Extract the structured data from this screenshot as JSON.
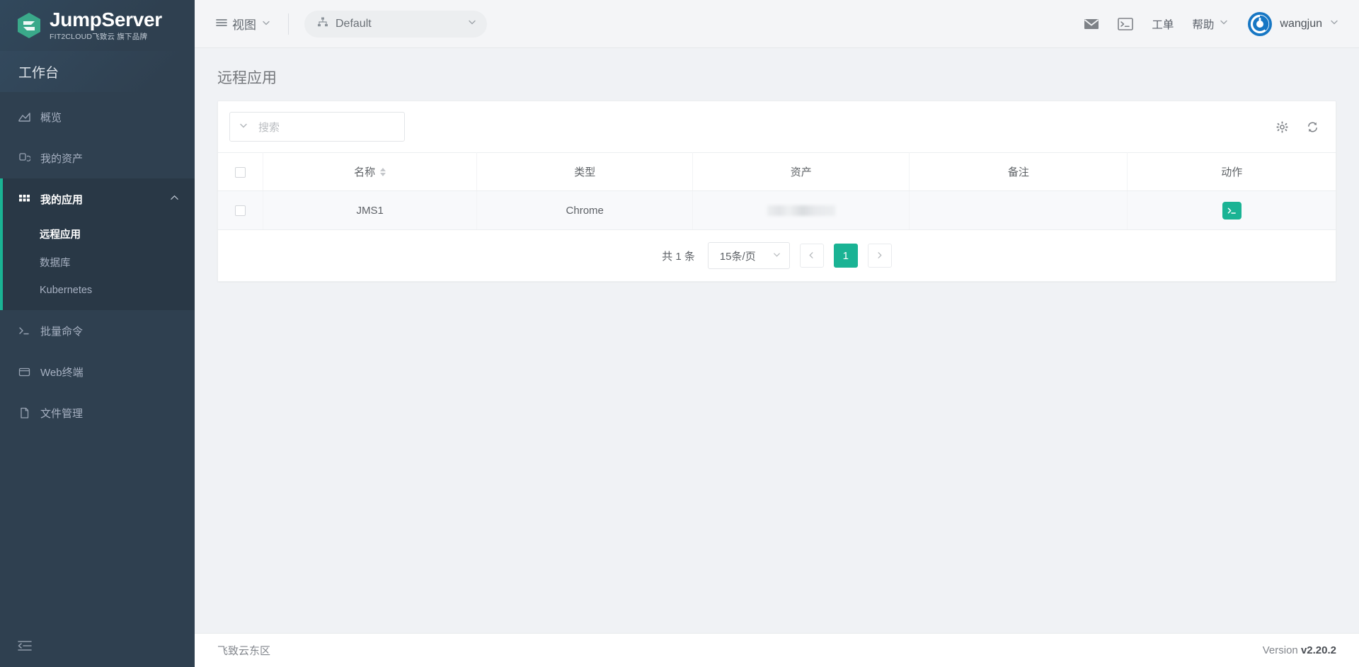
{
  "brand": {
    "logo_title": "JumpServer",
    "logo_subtitle": "FIT2CLOUD飞致云 旗下品牌",
    "logo_icon": "jumpserver-hexagon-logo",
    "accent_color": "#1ab394",
    "sidebar_bg": "#2f4050"
  },
  "sidebar": {
    "workbench_label": "工作台",
    "items": [
      {
        "label": "概览",
        "icon": "chart-area-icon",
        "active": false
      },
      {
        "label": "我的资产",
        "icon": "assets-icon",
        "active": false
      },
      {
        "label": "我的应用",
        "icon": "grid-apps-icon",
        "active": true,
        "chevron": "chevron-up-icon"
      },
      {
        "label": "批量命令",
        "icon": "terminal-prompt-icon",
        "active": false
      },
      {
        "label": "Web终端",
        "icon": "window-icon",
        "active": false
      },
      {
        "label": "文件管理",
        "icon": "file-icon",
        "active": false
      }
    ],
    "submenu": [
      {
        "label": "远程应用",
        "active": true
      },
      {
        "label": "数据库",
        "active": false
      },
      {
        "label": "Kubernetes",
        "active": false
      }
    ],
    "collapse_icon": "sidebar-collapse-icon"
  },
  "topbar": {
    "view_label": "视图",
    "view_icon": "hamburger-icon",
    "view_chevron": "chevron-down-icon",
    "org_name": "Default",
    "org_icon": "sitemap-icon",
    "org_chevron": "chevron-down-icon",
    "mail_icon": "envelope-icon",
    "terminal_icon": "terminal-window-icon",
    "ticket_label": "工单",
    "help_label": "帮助",
    "help_chevron": "chevron-down-icon",
    "avatar_icon": "user-avatar-logo",
    "username": "wangjun",
    "user_chevron": "chevron-down-icon"
  },
  "page": {
    "title": "远程应用"
  },
  "toolbar": {
    "search_placeholder": "搜索",
    "search_value": "",
    "search_chevron_icon": "chevron-down-icon",
    "settings_icon": "gear-icon",
    "refresh_icon": "refresh-icon"
  },
  "table": {
    "columns": [
      {
        "key": "check",
        "label": ""
      },
      {
        "key": "name",
        "label": "名称",
        "sortable": true
      },
      {
        "key": "type",
        "label": "类型",
        "sortable": false
      },
      {
        "key": "asset",
        "label": "资产",
        "sortable": false
      },
      {
        "key": "note",
        "label": "备注",
        "sortable": false
      },
      {
        "key": "action",
        "label": "动作",
        "sortable": false
      }
    ],
    "rows": [
      {
        "name": "JMS1",
        "type": "Chrome",
        "asset": "",
        "asset_redacted": true,
        "note": "",
        "action_icon": "terminal-connect-icon"
      }
    ]
  },
  "pagination": {
    "total_text": "共 1 条",
    "page_size_label": "15条/页",
    "page_size_chevron": "chevron-down-icon",
    "prev_icon": "chevron-left-icon",
    "next_icon": "chevron-right-icon",
    "current_page": "1"
  },
  "footer": {
    "left_text": "飞致云东区",
    "version_label": "Version",
    "version_value": "v2.20.2"
  }
}
